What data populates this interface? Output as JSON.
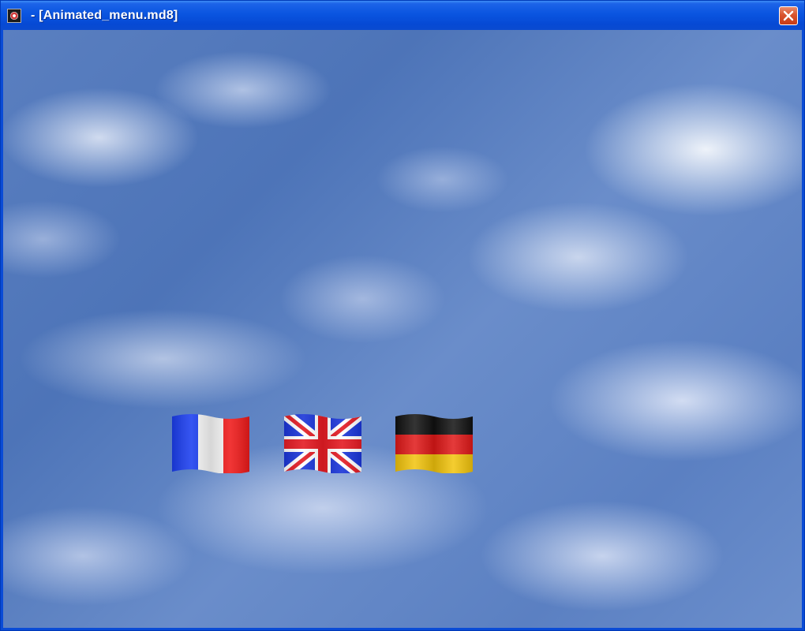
{
  "window": {
    "title": " - [Animated_menu.md8]",
    "icon": "app-icon",
    "close_icon": "close-icon",
    "accent_color": "#0a4bd6"
  },
  "content": {
    "background": "sky-with-clouds",
    "flags": [
      {
        "name": "France",
        "icon": "flag-france-icon",
        "colors": [
          "#1b3ef0",
          "#f4f4f4",
          "#ef1a1a"
        ]
      },
      {
        "name": "United Kingdom",
        "icon": "flag-uk-icon",
        "colors": [
          "#1a35d8",
          "#ffffff",
          "#e31b23"
        ]
      },
      {
        "name": "Germany",
        "icon": "flag-germany-icon",
        "colors": [
          "#111111",
          "#e01818",
          "#f2c40c"
        ]
      }
    ]
  }
}
